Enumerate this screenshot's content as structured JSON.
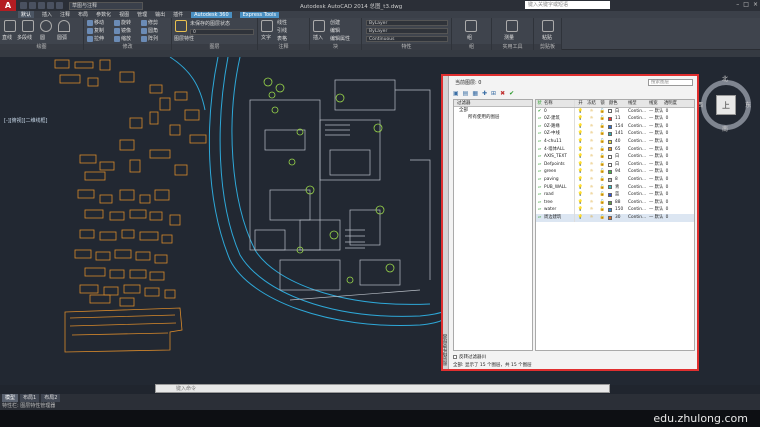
{
  "app": {
    "title": "Autodesk AutoCAD 2014    总图_t3.dwg",
    "workspace": "草图与注释",
    "search_placeholder": "键入关键字或短语",
    "logo": "A"
  },
  "ribbon_tabs": [
    "默认",
    "插入",
    "注释",
    "布局",
    "参数化",
    "视图",
    "管理",
    "输出",
    "插件",
    "Autodesk 360",
    "Express Tools"
  ],
  "ribbon_groups": [
    {
      "label": "绘图",
      "tools": [
        "直线",
        "多段线",
        "圆",
        "圆弧"
      ]
    },
    {
      "label": "修改",
      "tools": [
        "移动",
        "旋转",
        "修剪",
        "复制",
        "镜像",
        "圆角",
        "拉伸",
        "缩放",
        "阵列"
      ]
    },
    {
      "label": "图层",
      "tools": [
        "未保存的图层状态",
        "图层特性"
      ]
    },
    {
      "label": "注释",
      "tools": [
        "文字",
        "线性",
        "引线",
        "表格"
      ]
    },
    {
      "label": "块",
      "tools": [
        "插入",
        "创建",
        "编辑",
        "编辑属性"
      ]
    },
    {
      "label": "特性",
      "tools": [
        "ByLayer",
        "ByLayer",
        "Continuous",
        "特性匹配"
      ]
    },
    {
      "label": "组",
      "tools": [
        "组"
      ]
    },
    {
      "label": "实用工具",
      "tools": [
        "测量"
      ]
    },
    {
      "label": "剪贴板",
      "tools": [
        "粘贴"
      ]
    }
  ],
  "viewport_label": "[-][俯视][二维线框]",
  "command_placeholder": "键入命令",
  "layout_tabs": [
    "模型",
    "布局1",
    "布局2"
  ],
  "status_text": "特性栏: 图层特性管理器",
  "watermark": "edu.zhulong.com",
  "compass": {
    "n": "北",
    "s": "南",
    "e": "东",
    "w": "西",
    "top": "上"
  },
  "layer_panel": {
    "title": "图层特性管理器",
    "current_layer": "当前图层: 0",
    "search_placeholder": "搜索图层",
    "tree_header": "过滤器",
    "tree_items": [
      "全部",
      "所有使用的图层"
    ],
    "columns": [
      "状",
      "名称",
      "开",
      "冻结",
      "锁",
      "颜色",
      "线型",
      "线宽",
      "透明度"
    ],
    "layers": [
      {
        "name": "0",
        "color_hex": "#ffffff",
        "color": "白",
        "linetype": "Contin...",
        "lineweight": "— 默认",
        "t": "0"
      },
      {
        "name": "0Z-建筑",
        "color_hex": "#ff3030",
        "color": "11",
        "linetype": "Contin...",
        "lineweight": "— 默认",
        "t": "0"
      },
      {
        "name": "0Z-路缘",
        "color_hex": "#2f6fd0",
        "color": "154",
        "linetype": "Contin...",
        "lineweight": "— 默认",
        "t": "0"
      },
      {
        "name": "0Z-中线",
        "color_hex": "#30b0b0",
        "color": "141",
        "linetype": "Contin...",
        "lineweight": "— 默认",
        "t": "0"
      },
      {
        "name": "4-chu11",
        "color_hex": "#e8e040",
        "color": "40",
        "linetype": "Contin...",
        "lineweight": "— 默认",
        "t": "0"
      },
      {
        "name": "4-墙体ALL",
        "color_hex": "#e8a030",
        "color": "65",
        "linetype": "Contin...",
        "lineweight": "— 默认",
        "t": "0"
      },
      {
        "name": "AXIS_TEXT",
        "color_hex": "#ffffff",
        "color": "白",
        "linetype": "Contin...",
        "lineweight": "— 默认",
        "t": "0"
      },
      {
        "name": "Defpoints",
        "color_hex": "#ffffff",
        "color": "白",
        "linetype": "Contin...",
        "lineweight": "— 默认",
        "t": "0"
      },
      {
        "name": "green",
        "color_hex": "#40c040",
        "color": "94",
        "linetype": "Contin...",
        "lineweight": "— 默认",
        "t": "0"
      },
      {
        "name": "paving",
        "color_hex": "#c0c0c0",
        "color": "8",
        "linetype": "Contin...",
        "lineweight": "— 默认",
        "t": "0"
      },
      {
        "name": "PUB_WALL",
        "color_hex": "#30c0c0",
        "color": "青",
        "linetype": "Contin...",
        "lineweight": "— 默认",
        "t": "0"
      },
      {
        "name": "road",
        "color_hex": "#3050e0",
        "color": "蓝",
        "linetype": "Contin...",
        "lineweight": "— 默认",
        "t": "0"
      },
      {
        "name": "tree",
        "color_hex": "#60a040",
        "color": "88",
        "linetype": "Contin...",
        "lineweight": "— 默认",
        "t": "0"
      },
      {
        "name": "water",
        "color_hex": "#3090e0",
        "color": "150",
        "linetype": "Contin...",
        "lineweight": "— 默认",
        "t": "0"
      },
      {
        "name": "周边建筑",
        "color_hex": "#e07020",
        "color": "30",
        "linetype": "Contin...",
        "lineweight": "— 默认",
        "t": "0"
      }
    ],
    "filter_label": "反转过滤器(I)",
    "status": "全部: 显示了 15 个图层，共 15 个图层"
  }
}
